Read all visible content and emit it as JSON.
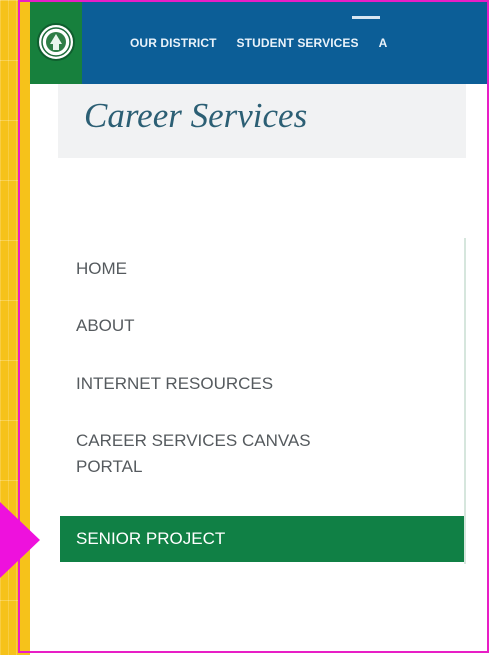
{
  "nav": {
    "items": [
      "OUR DISTRICT",
      "STUDENT SERVICES",
      "A"
    ]
  },
  "page": {
    "title": "Career Services"
  },
  "sidebar": {
    "items": [
      {
        "label": "HOME"
      },
      {
        "label": "ABOUT"
      },
      {
        "label": "INTERNET RESOURCES"
      },
      {
        "label_line1": "CAREER SERVICES CANVAS",
        "label_line2": "PORTAL"
      },
      {
        "label": "SENIOR PROJECT",
        "active": true
      }
    ]
  },
  "colors": {
    "nav_blue": "#0c5e97",
    "logo_green": "#17803d",
    "active_green": "#108045",
    "title_teal": "#2c5f74",
    "frame_magenta": "#e81ec6",
    "gutter_yellow": "#f6c21a"
  }
}
